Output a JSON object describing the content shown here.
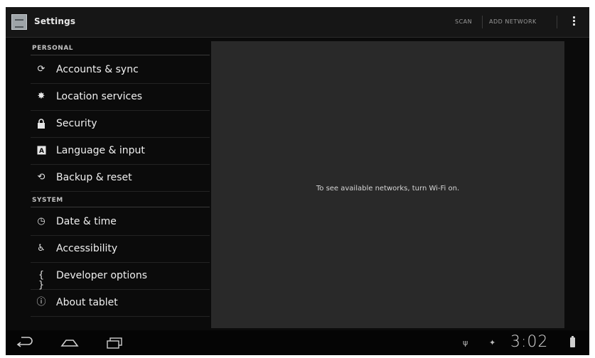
{
  "actionbar": {
    "title": "Settings",
    "scan_label": "SCAN",
    "add_network_label": "ADD NETWORK"
  },
  "sections": {
    "personal": "PERSONAL",
    "system": "SYSTEM"
  },
  "personal_items": [
    {
      "label": "Accounts & sync",
      "icon": "sync-icon"
    },
    {
      "label": "Location services",
      "icon": "location-icon"
    },
    {
      "label": "Security",
      "icon": "lock-icon"
    },
    {
      "label": "Language & input",
      "icon": "keyboard-icon"
    },
    {
      "label": "Backup & reset",
      "icon": "backup-icon"
    }
  ],
  "system_items": [
    {
      "label": "Date & time",
      "icon": "clock-icon"
    },
    {
      "label": "Accessibility",
      "icon": "accessibility-icon"
    },
    {
      "label": "Developer options",
      "icon": "developer-icon"
    },
    {
      "label": "About tablet",
      "icon": "info-icon"
    }
  ],
  "content": {
    "message": "To see available networks, turn Wi-Fi on."
  },
  "systembar": {
    "clock": "3:02"
  },
  "colors": {
    "background": "#0b0b0b",
    "pane": "#292929",
    "text": "#f0f0f0"
  }
}
